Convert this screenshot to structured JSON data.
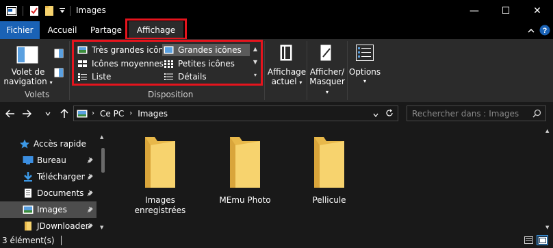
{
  "window": {
    "title": "Images",
    "minimize_glyph": "—",
    "maximize_glyph": "☐",
    "close_glyph": "✕"
  },
  "tabs": [
    {
      "label": "Fichier"
    },
    {
      "label": "Accueil"
    },
    {
      "label": "Partage"
    },
    {
      "label": "Affichage"
    }
  ],
  "ribbon": {
    "panes": {
      "nav_pane_line1": "Volet de",
      "nav_pane_line2": "navigation",
      "group_label": "Volets"
    },
    "layout": {
      "group_label": "Disposition",
      "items": [
        {
          "label": "Très grandes icônes"
        },
        {
          "label": "Grandes icônes"
        },
        {
          "label": "Icônes moyennes"
        },
        {
          "label": "Petites icônes"
        },
        {
          "label": "Liste"
        },
        {
          "label": "Détails"
        }
      ],
      "selected": "Grandes icônes"
    },
    "current_view": {
      "line1": "Affichage",
      "line2": "actuel"
    },
    "show_hide": {
      "line1": "Afficher/",
      "line2": "Masquer"
    },
    "options": {
      "label": "Options"
    }
  },
  "address": {
    "crumbs": [
      "Ce PC",
      "Images"
    ],
    "search_placeholder": "Rechercher dans : Images"
  },
  "sidebar": {
    "items": [
      {
        "label": "Accès rapide"
      },
      {
        "label": "Bureau"
      },
      {
        "label": "Téléchargeme"
      },
      {
        "label": "Documents"
      },
      {
        "label": "Images"
      },
      {
        "label": "JDownloader"
      }
    ]
  },
  "folders": [
    {
      "line1": "Images",
      "line2": "enregistrées"
    },
    {
      "line1": "MEmu Photo",
      "line2": ""
    },
    {
      "line1": "Pellicule",
      "line2": ""
    }
  ],
  "status": {
    "count_text": "3 élément(s)"
  },
  "colors": {
    "accent": "#1a62b5",
    "highlight_box": "#e5141d",
    "folder": "#f7d36e",
    "folder_back": "#e8b84a"
  }
}
